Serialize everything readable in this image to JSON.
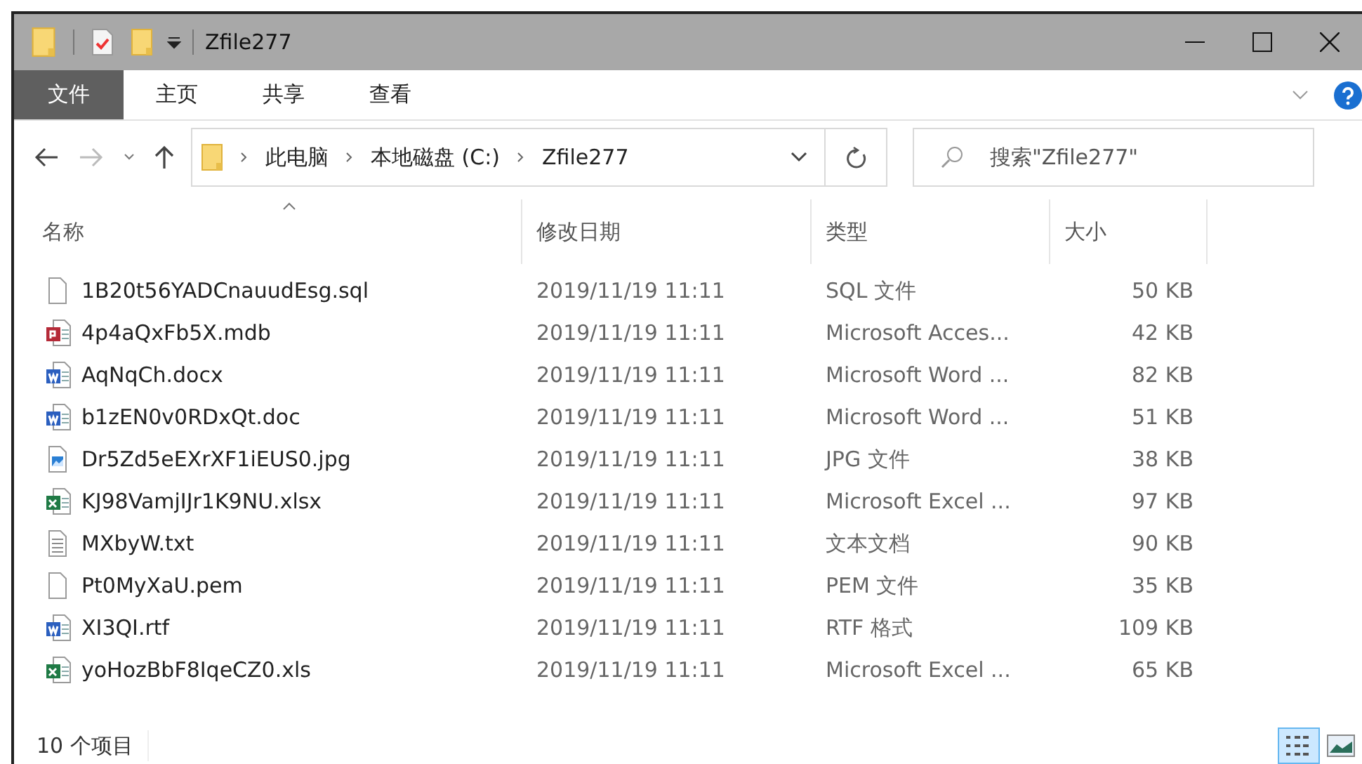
{
  "window": {
    "title": "Zfile277"
  },
  "ribbon_tabs": [
    {
      "label": "文件",
      "kind": "file"
    },
    {
      "label": "主页",
      "kind": "tab"
    },
    {
      "label": "共享",
      "kind": "tab"
    },
    {
      "label": "查看",
      "kind": "tab"
    }
  ],
  "breadcrumbs": [
    "此电脑",
    "本地磁盘 (C:)",
    "Zfile277"
  ],
  "search": {
    "placeholder": "搜索\"Zfile277\""
  },
  "columns": [
    {
      "label": "名称",
      "sorted": true
    },
    {
      "label": "修改日期",
      "sorted": false
    },
    {
      "label": "类型",
      "sorted": false
    },
    {
      "label": "大小",
      "sorted": false
    }
  ],
  "rows": [
    {
      "name": "1B20t56YADCnauudEsg.sql",
      "kind": "blank",
      "modified": "2019/11/19 11:11",
      "type": "SQL 文件",
      "size": "50 KB"
    },
    {
      "name": "4p4aQxFb5X.mdb",
      "kind": "access",
      "modified": "2019/11/19 11:11",
      "type": "Microsoft Acces...",
      "size": "42 KB"
    },
    {
      "name": "AqNqCh.docx",
      "kind": "word",
      "modified": "2019/11/19 11:11",
      "type": "Microsoft Word ...",
      "size": "82 KB"
    },
    {
      "name": "b1zEN0v0RDxQt.doc",
      "kind": "word",
      "modified": "2019/11/19 11:11",
      "type": "Microsoft Word ...",
      "size": "51 KB"
    },
    {
      "name": "Dr5Zd5eEXrXF1iEUS0.jpg",
      "kind": "image",
      "modified": "2019/11/19 11:11",
      "type": "JPG 文件",
      "size": "38 KB"
    },
    {
      "name": "KJ98VamjIJr1K9NU.xlsx",
      "kind": "excel",
      "modified": "2019/11/19 11:11",
      "type": "Microsoft Excel ...",
      "size": "97 KB"
    },
    {
      "name": "MXbyW.txt",
      "kind": "text",
      "modified": "2019/11/19 11:11",
      "type": "文本文档",
      "size": "90 KB"
    },
    {
      "name": "Pt0MyXaU.pem",
      "kind": "blank",
      "modified": "2019/11/19 11:11",
      "type": "PEM 文件",
      "size": "35 KB"
    },
    {
      "name": "XI3QI.rtf",
      "kind": "word",
      "modified": "2019/11/19 11:11",
      "type": "RTF 格式",
      "size": "109 KB"
    },
    {
      "name": "yoHozBbF8IqeCZ0.xls",
      "kind": "excel",
      "modified": "2019/11/19 11:11",
      "type": "Microsoft Excel ...",
      "size": "65 KB"
    }
  ],
  "status_bar": {
    "count": "10 个项目"
  },
  "view_buttons": [
    {
      "kind": "details",
      "selected": true
    },
    {
      "kind": "large_icons",
      "selected": false
    }
  ]
}
